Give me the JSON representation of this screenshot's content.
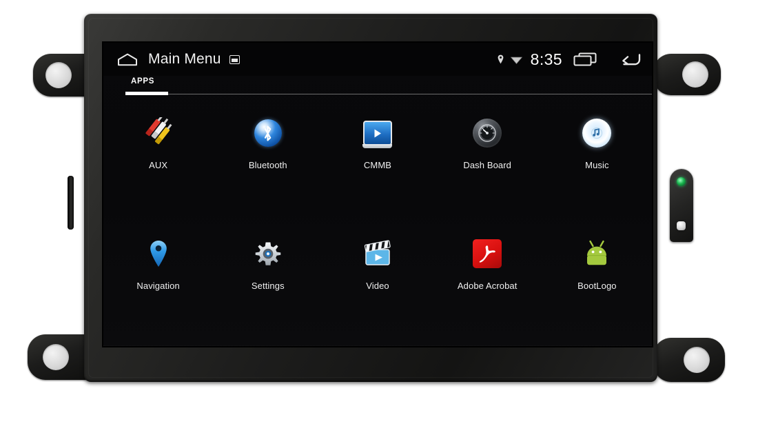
{
  "device": {
    "name": "car-head-unit",
    "chassis_color": "#1d1d1c",
    "led_color": "#19b34d"
  },
  "statusbar": {
    "home_icon": "home-icon",
    "title": "Main Menu",
    "title_badge_icon": "screen-badge-icon",
    "location_icon": "location-pin-icon",
    "wifi_icon": "wifi-icon",
    "time": "8:35",
    "recents_icon": "recent-apps-icon",
    "back_icon": "back-arrow-icon"
  },
  "tabs": {
    "items": [
      {
        "label": "APPS",
        "selected": true
      }
    ]
  },
  "apps": [
    {
      "label": "AUX",
      "icon": "rca-cables-icon"
    },
    {
      "label": "Bluetooth",
      "icon": "bluetooth-icon"
    },
    {
      "label": "CMMB",
      "icon": "cmmb-tv-icon"
    },
    {
      "label": "Dash Board",
      "icon": "gauge-icon"
    },
    {
      "label": "Music",
      "icon": "music-orb-icon"
    },
    {
      "label": "Navigation",
      "icon": "map-pin-icon"
    },
    {
      "label": "Settings",
      "icon": "gear-icon"
    },
    {
      "label": "Video",
      "icon": "clapperboard-icon"
    },
    {
      "label": "Adobe Acrobat",
      "icon": "adobe-acrobat-icon"
    },
    {
      "label": "BootLogo",
      "icon": "android-robot-icon"
    }
  ],
  "hardware": {
    "card_slot": "card-slot",
    "side_led": "status-led",
    "side_button": "reset-button",
    "mount_holes": 4
  },
  "colors": {
    "accent_white": "#ffffff",
    "screen_bg": "#09090b",
    "bluetooth_blue": "#2f86de",
    "acrobat_red": "#d8100f",
    "android_green": "#a4c93e",
    "nav_pin_blue": "#2f9ae8"
  }
}
